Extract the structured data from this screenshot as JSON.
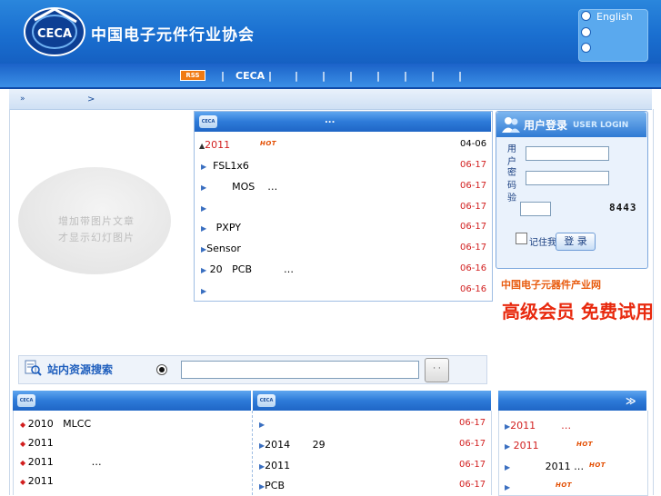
{
  "header": {
    "logo_text": "CECA",
    "site_title": "中国电子元件行业协会",
    "languages": [
      "English",
      "",
      ""
    ]
  },
  "nav": {
    "rss_label": "RSS",
    "items": [
      "|",
      "CECA |",
      "|",
      "|",
      "|",
      "|",
      "|",
      "|"
    ]
  },
  "breadcrumb": {
    "separator": ">"
  },
  "slideshow": {
    "line1": "增加带图片文章",
    "line2": "才显示幻灯图片"
  },
  "news_panel": {
    "logo_text": "CECA",
    "title": "...",
    "items": [
      {
        "text": "2011",
        "date": "04-06",
        "hot": true,
        "first": true
      },
      {
        "text": "  FSL1x6",
        "date": "06-17",
        "hot": false
      },
      {
        "text": "        MOS    …",
        "date": "06-17",
        "hot": false
      },
      {
        "text": "",
        "date": "06-17",
        "hot": false
      },
      {
        "text": "   PXPY",
        "date": "06-17",
        "hot": false
      },
      {
        "text": "Sensor",
        "date": "06-17",
        "hot": false
      },
      {
        "text": " 20   PCB          …",
        "date": "06-16",
        "hot": false
      },
      {
        "text": "",
        "date": "06-16",
        "hot": false
      }
    ],
    "hot_label": "HOT"
  },
  "login": {
    "title": "用户登录",
    "subtitle": "USER LOGIN",
    "username_label": "用 户",
    "password_label": "密 码",
    "code_label": "验",
    "captcha": "8443",
    "remember_label": "记住我",
    "submit_label": "登 录"
  },
  "ad": {
    "top": "中国电子元器件产业网",
    "main": "高级会员 免费试用"
  },
  "search": {
    "label": "站内资源搜索",
    "button": "· ·",
    "value": ""
  },
  "bottom_left": {
    "logo_text": "CECA",
    "items": [
      "2010   MLCC",
      "2011",
      "2011            …",
      "2011"
    ]
  },
  "bottom_mid": {
    "logo_text": "CECA",
    "items": [
      {
        "text": "",
        "date": "06-17"
      },
      {
        "text": "2014       29",
        "date": "06-17"
      },
      {
        "text": "2011",
        "date": "06-17"
      },
      {
        "text": "PCB",
        "date": "06-17"
      }
    ]
  },
  "bottom_right": {
    "items": [
      {
        "text": "2011        …",
        "hot": false
      },
      {
        "text": " 2011",
        "hot": true
      },
      {
        "text": "           2011 …",
        "hot": true
      },
      {
        "text": "",
        "hot": true
      }
    ],
    "hot_label": "HOT"
  },
  "colors": {
    "header_blue": "#1a6fd0",
    "date_red": "#d21f1f",
    "hot_orange": "#e34d00",
    "ad_red": "#e8290e"
  }
}
